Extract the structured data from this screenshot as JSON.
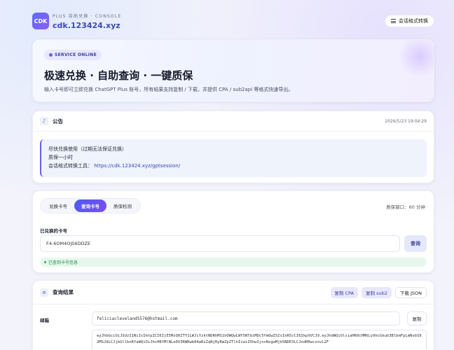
{
  "header": {
    "logo_text": "CDK",
    "subtitle": "PLUS 自助兑换 · CONSOLE",
    "domain": "cdk.123424.xyz",
    "convert_button": "会话格式转换"
  },
  "hero": {
    "badge": "SERVICE ONLINE",
    "title": "极速兑换 · 自助查询 · 一键质保",
    "description": "输入卡号即可立即兑换 ChatGPT Plus 账号，所有结果支持复制 / 下载，并提供 CPA / sub2api 等格式快速导出。"
  },
  "notice": {
    "title": "公告",
    "timestamp": "2026/5/23 19:04:29",
    "lines": [
      "尽快兑换使用（过期无法保证兑换）",
      "质保一小时"
    ],
    "link_label": "会话格式转换工具：",
    "link_url": "https://cdk.123424.xyz/gptsession/"
  },
  "query": {
    "tabs": [
      "兑换卡号",
      "查询卡号",
      "质保检测"
    ],
    "active_tab": 1,
    "warranty_window": "质保窗口：60 分钟",
    "field_label": "已兑换的卡号",
    "card_value": "F4-6OM4OJS6DDZE",
    "query_button": "查询",
    "status_text": "已查到卡号信息"
  },
  "result": {
    "title": "查询结果",
    "buttons": [
      "复制 CPA",
      "复制 sub2",
      "下载 JSON"
    ],
    "email_label": "邮箱",
    "email_value": "feliciacleveland5576@hotmail.com",
    "copy_button": "复制",
    "token_value": "eyJhbGciOiJSUzI1NiIsImtpZCI6IjE5MzQ0ZTY1LWJiYzktNDRhMS1hOWQwLWY5NTdiMDc5YmQwZSIsInR5cCI6IkpXVCJ9.eyJhdWQiOlsiaHR0cHM6Ly9hcGkub3BlbmFpLmNvbS92MSJdLCJjbGllbnRfaWQiOiJhcHBfMlNLeDV3RWRwb04wRzZqNjRyRmZpZTlhIiwiZXhwIjoxNzgwMjk5NDE3LCJodHRwczovL2F"
  }
}
